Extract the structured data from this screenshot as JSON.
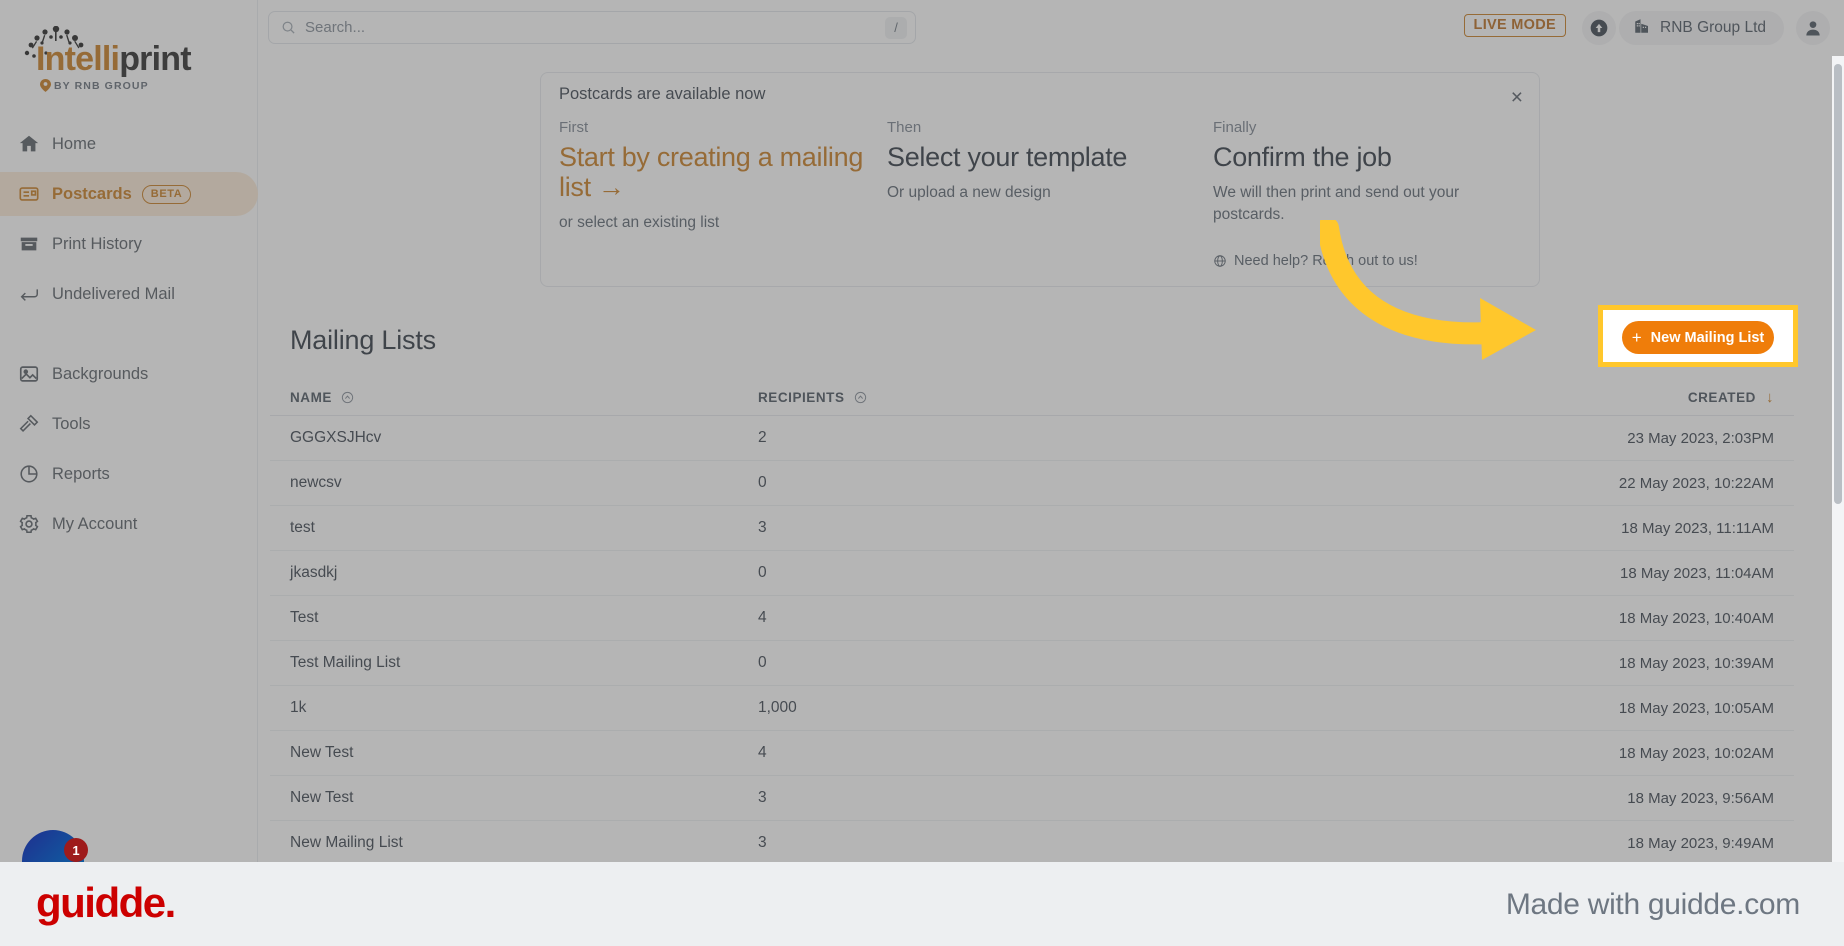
{
  "brand": {
    "logo_primary": "Intelli",
    "logo_secondary": "print",
    "logo_sub": "BY RNB GROUP",
    "accent": "#c4720e",
    "button_orange": "#ef7d0a",
    "highlight_yellow": "#ffc72c"
  },
  "header": {
    "search_placeholder": "Search...",
    "search_value": "",
    "slash_key": "/",
    "live_mode": "LIVE MODE",
    "org_name": "RNB Group Ltd"
  },
  "sidebar": {
    "items": [
      {
        "label": "Home",
        "icon": "home-icon",
        "active": false,
        "badge": ""
      },
      {
        "label": "Postcards",
        "icon": "postcard-icon",
        "active": true,
        "badge": "BETA"
      },
      {
        "label": "Print History",
        "icon": "archive-icon",
        "active": false,
        "badge": ""
      },
      {
        "label": "Undelivered Mail",
        "icon": "return-arrow-icon",
        "active": false,
        "badge": ""
      },
      {
        "label": "Backgrounds",
        "icon": "image-icon",
        "active": false,
        "badge": ""
      },
      {
        "label": "Tools",
        "icon": "hammer-icon",
        "active": false,
        "badge": ""
      },
      {
        "label": "Reports",
        "icon": "pie-chart-icon",
        "active": false,
        "badge": ""
      },
      {
        "label": "My Account",
        "icon": "gear-icon",
        "active": false,
        "badge": ""
      }
    ]
  },
  "banner": {
    "title": "Postcards are available now",
    "close": "×",
    "steps": [
      {
        "step": "First",
        "head": "Start by creating a mailing list →",
        "sub": "or select an existing list"
      },
      {
        "step": "Then",
        "head": "Select your template",
        "sub": "Or upload a new design"
      },
      {
        "step": "Finally",
        "head": "Confirm the job",
        "sub": "We will then print and send out your postcards."
      }
    ],
    "help": "Need help? Reach out to us!"
  },
  "main": {
    "title": "Mailing Lists",
    "new_button": "New Mailing List",
    "new_button_plus": "+",
    "columns": [
      {
        "label": "NAME",
        "sort": "inactive"
      },
      {
        "label": "RECIPIENTS",
        "sort": "inactive"
      },
      {
        "label": "CREATED",
        "sort": "desc"
      }
    ],
    "rows": [
      {
        "name": "GGGXSJHcv",
        "recipients": "2",
        "created": "23 May 2023, 2:03PM"
      },
      {
        "name": "newcsv",
        "recipients": "0",
        "created": "22 May 2023, 10:22AM"
      },
      {
        "name": "test",
        "recipients": "3",
        "created": "18 May 2023, 11:11AM"
      },
      {
        "name": "jkasdkj",
        "recipients": "0",
        "created": "18 May 2023, 11:04AM"
      },
      {
        "name": "Test",
        "recipients": "4",
        "created": "18 May 2023, 10:40AM"
      },
      {
        "name": "Test Mailing List",
        "recipients": "0",
        "created": "18 May 2023, 10:39AM"
      },
      {
        "name": "1k",
        "recipients": "1,000",
        "created": "18 May 2023, 10:05AM"
      },
      {
        "name": "New Test",
        "recipients": "4",
        "created": "18 May 2023, 10:02AM"
      },
      {
        "name": "New Test",
        "recipients": "3",
        "created": "18 May 2023, 9:56AM"
      },
      {
        "name": "New Mailing List",
        "recipients": "3",
        "created": "18 May 2023, 9:49AM"
      }
    ]
  },
  "chat": {
    "badge_count": "1"
  },
  "footer": {
    "logo": "guidde.",
    "made_with": "Made with guidde.com"
  }
}
